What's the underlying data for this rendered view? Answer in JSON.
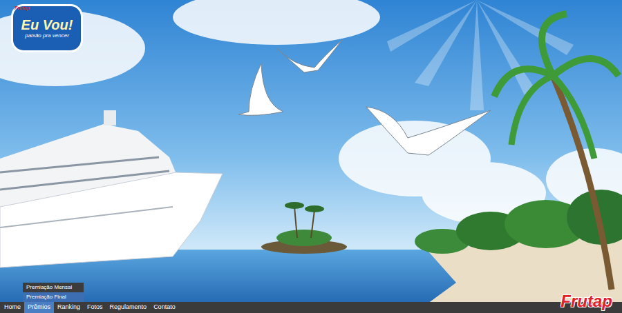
{
  "logo": {
    "brand": "Frutap",
    "title": "Eu Vou!",
    "tagline": "paixão pra vencer"
  },
  "nav": {
    "items": [
      {
        "label": "Home",
        "selected": false
      },
      {
        "label": "Prêmios",
        "selected": true
      },
      {
        "label": "Ranking",
        "selected": false
      },
      {
        "label": "Fotos",
        "selected": false
      },
      {
        "label": "Regulamento",
        "selected": false
      },
      {
        "label": "Contato",
        "selected": false
      }
    ]
  },
  "dropdown": {
    "items": [
      {
        "label": "Premiação Mensal",
        "selected": false
      },
      {
        "label": "Premiação Final",
        "selected": true
      }
    ]
  },
  "corner_logo": {
    "label": "Frutap"
  }
}
